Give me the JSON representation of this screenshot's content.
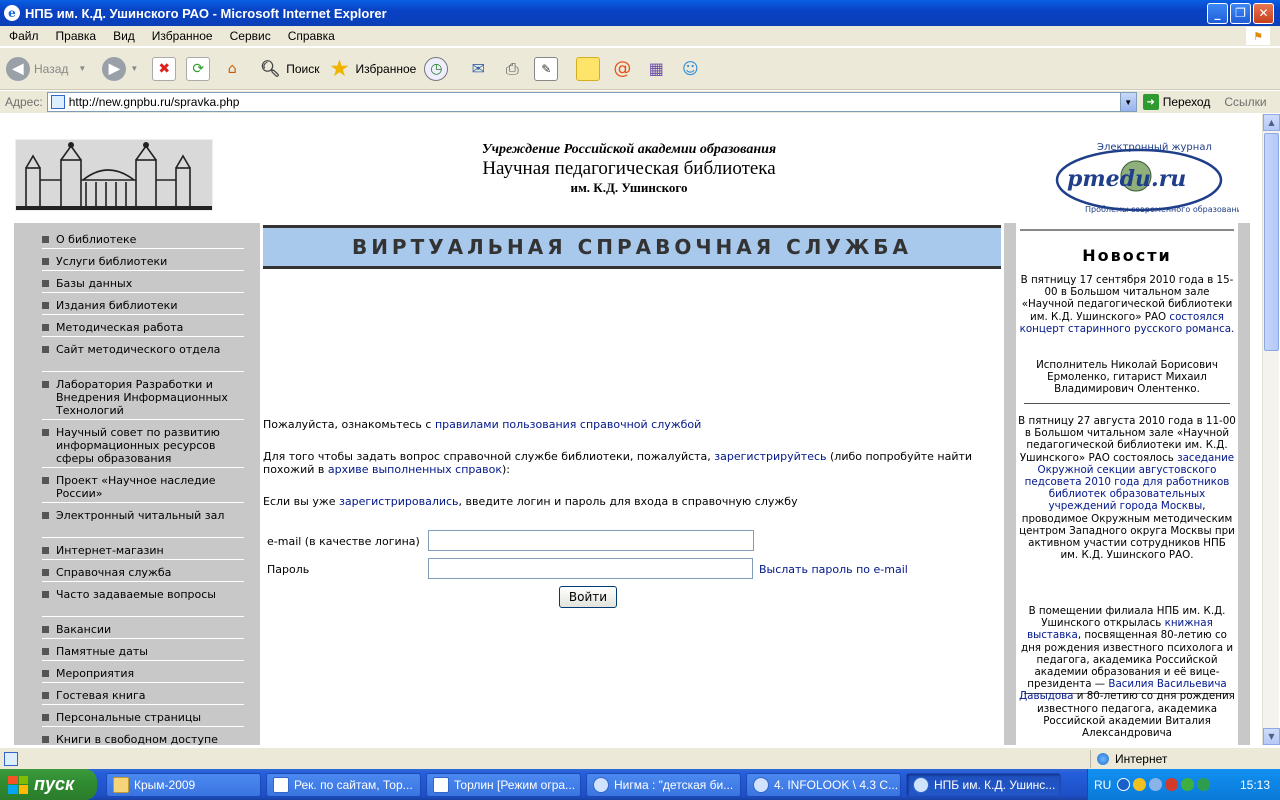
{
  "window": {
    "title": "НПБ им. К.Д. Ушинского РАО - Microsoft Internet Explorer",
    "controls": [
      "_",
      "❐",
      "✕"
    ]
  },
  "menu": [
    "Файл",
    "Правка",
    "Вид",
    "Избранное",
    "Сервис",
    "Справка"
  ],
  "toolbar": {
    "back": "Назад",
    "search": "Поиск",
    "favorites": "Избранное"
  },
  "address": {
    "label": "Адрес:",
    "url": "http://new.gnpbu.ru/spravka.php",
    "go": "Переход",
    "links": "Ссылки"
  },
  "header": {
    "line1": "Учреждение Российской академии образования",
    "line2": "Научная педагогическая библиотека",
    "line3": "им. К.Д. Ушинского",
    "journal_caption": "Электронный журнал",
    "journal_name": "pmedu.ru",
    "journal_sub": "Проблемы современного образования"
  },
  "nav": [
    "О библиотеке",
    "Услуги библиотеки",
    "Базы данных",
    "Издания библиотеки",
    "Методическая работа",
    "Сайт методического отдела",
    "Лаборатория Разработки и Внедрения Информационных Технологий",
    "Научный совет по развитию информационных ресурсов сферы образования",
    "Проект «Научное наследие России»",
    "Электронный читальный зал",
    "Интернет-магазин",
    "Справочная служба",
    "Часто задаваемые вопросы",
    "Вакансии",
    "Памятные даты",
    "Мероприятия",
    "Гостевая книга",
    "Персональные страницы",
    "Книги в свободном доступе"
  ],
  "main": {
    "banner": "ВИРТУАЛЬНАЯ СПРАВОЧНАЯ СЛУЖБА",
    "p1_text": "Пожалуйста, ознакомьтесь с ",
    "p1_link": "правилами пользования справочной службой",
    "p2_a": "Для того чтобы задать вопрос справочной службе библиотеки, пожалуйста, ",
    "p2_link1": "зарегистрируйтесь",
    "p2_b": " (либо попробуйте найти похожий в ",
    "p2_link2": "архиве выполненных справок",
    "p2_c": "):",
    "p3_a": "Если вы уже ",
    "p3_link": "зарегистрировались",
    "p3_b": ", введите логин и пароль для входа в справочную службу",
    "login_label": "e-mail (в качестве логина)",
    "password_label": "Пароль",
    "send_password": "Выслать пароль по e-mail",
    "submit": "Войти"
  },
  "news": {
    "title": "Новости",
    "n1_text": "В пятницу 17 сентября 2010 года в 15-00 в Большом читальном зале «Научной педагогической библиотеки им. К.Д. Ушинского» РАО",
    "n1_link": "состоялся концерт старинного русского романса.",
    "n1_after": "Исполнитель Николай Борисович Ермоленко, гитарист Михаил Владимирович Олентенко.",
    "n2_text": "В пятницу 27 августа 2010 года в 11-00 в Большом читальном зале «Научной педагогической библиотеки им. К.Д. Ушинского» РАО состоялось",
    "n2_link": "заседание Окружной секции августовского педсовета 2010 года для работников библиотек образовательных учреждений города Москвы",
    "n2_after": ", проводимое Окружным методическим центром Западного округа Москвы при активном участии сотрудников НПБ им. К.Д. Ушинского РАО.",
    "n3_a": "В помещении филиала НПБ им. К.Д. Ушинского открылась",
    "n3_link1": "книжная выставка",
    "n3_b": ", посвященная 80-летию со дня рождения известного психолога и педагога, академика Российской академии образования и её вице-президента —",
    "n3_link2": "Василия Васильевича Давыдова",
    "n3_c": "и 80-летию со дня рождения известного педагога, академика Российской академии Виталия Александровича"
  },
  "status": {
    "zone": "Интернет"
  },
  "taskbar": {
    "start": "пуск",
    "tasks": [
      "Крым-2009",
      "Рек. по сайтам, Тор...",
      "Торлин [Режим огра...",
      "Нигма : \"детская би...",
      "4. INFOLOOK \\ 4.3 С...",
      "НПБ им. К.Д. Ушинс..."
    ],
    "lang": "RU",
    "clock": "15:13"
  }
}
